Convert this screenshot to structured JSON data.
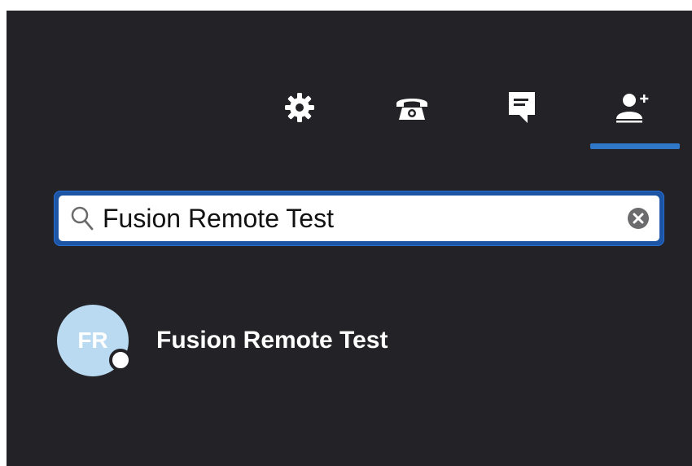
{
  "toolbar": {
    "items": [
      {
        "name": "settings",
        "icon": "gear-icon"
      },
      {
        "name": "calls",
        "icon": "phone-icon"
      },
      {
        "name": "chat",
        "icon": "chat-icon"
      },
      {
        "name": "contacts",
        "icon": "add-contact-icon",
        "active": true
      }
    ]
  },
  "search": {
    "value": "Fusion Remote Test",
    "icon": "search-icon",
    "clear_icon": "clear-icon"
  },
  "results": [
    {
      "initials": "FR",
      "name": "Fusion Remote Test",
      "presence": "available"
    }
  ],
  "colors": {
    "background": "#232227",
    "accent": "#2f77c8",
    "avatar": "#b9daf0",
    "icon": "#ffffff"
  }
}
